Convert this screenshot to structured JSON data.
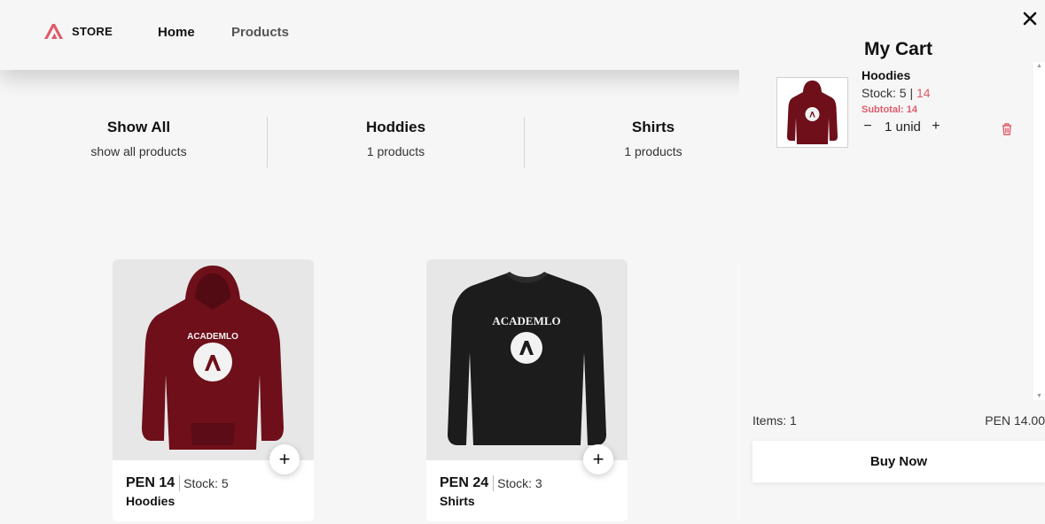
{
  "header": {
    "logo_text": "STORE",
    "nav": {
      "home": "Home",
      "products": "Products"
    }
  },
  "categories": [
    {
      "title": "Show All",
      "subtitle": "show all products"
    },
    {
      "title": "Hoddies",
      "subtitle": "1 products"
    },
    {
      "title": "Shirts",
      "subtitle": "1 products"
    }
  ],
  "products": [
    {
      "price": "PEN 14",
      "stock": "Stock: 5",
      "name": "Hoodies",
      "image_icon": "maroon-hoodie-image"
    },
    {
      "price": "PEN 24",
      "stock": "Stock: 3",
      "name": "Shirts",
      "image_icon": "black-sweatshirt-image"
    }
  ],
  "cart": {
    "title": "My Cart",
    "close_icon": "close-icon",
    "items": [
      {
        "name": "Hoodies",
        "stock_label": "Stock: 5 |",
        "price": "14",
        "subtotal": "Subtotal: 14",
        "quantity": "1 unid",
        "minus": "−",
        "plus": "+"
      }
    ],
    "items_count": "Items: 1",
    "total": "PEN 14.00",
    "buy_label": "Buy Now"
  },
  "colors": {
    "accent": "#e05a6a",
    "background": "#f6f6f6",
    "maroon": "#6e0f1a",
    "black": "#1c1c1c"
  }
}
